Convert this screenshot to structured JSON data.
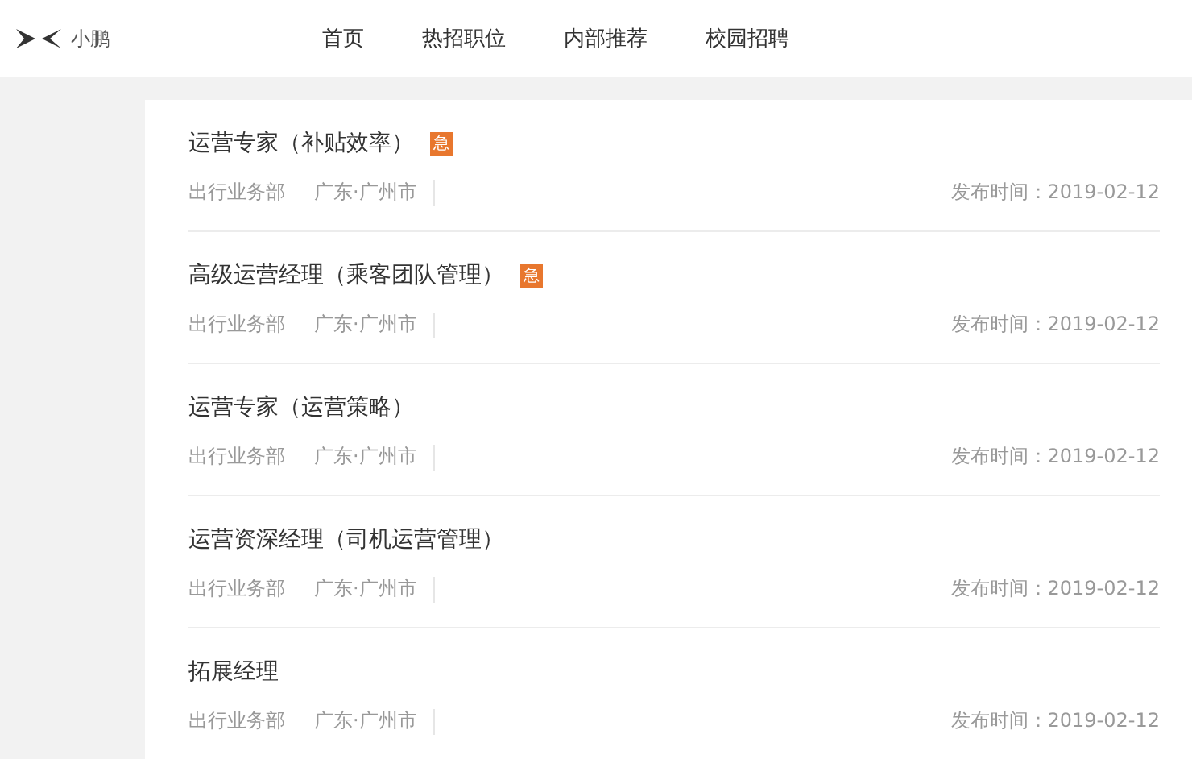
{
  "header": {
    "logo_text": "小鹏",
    "nav": [
      {
        "label": "首页"
      },
      {
        "label": "热招职位"
      },
      {
        "label": "内部推荐"
      },
      {
        "label": "校园招聘"
      }
    ]
  },
  "jobs": [
    {
      "title": "运营专家（补贴效率）",
      "badge": "急",
      "department": "出行业务部",
      "location": "广东·广州市",
      "published": "发布时间：2019-02-12"
    },
    {
      "title": "高级运营经理（乘客团队管理）",
      "badge": "急",
      "department": "出行业务部",
      "location": "广东·广州市",
      "published": "发布时间：2019-02-12"
    },
    {
      "title": "运营专家（运营策略）",
      "department": "出行业务部",
      "location": "广东·广州市",
      "published": "发布时间：2019-02-12"
    },
    {
      "title": "运营资深经理（司机运营管理）",
      "department": "出行业务部",
      "location": "广东·广州市",
      "published": "发布时间：2019-02-12"
    },
    {
      "title": "拓展经理",
      "department": "出行业务部",
      "location": "广东·广州市",
      "published": "发布时间：2019-02-12"
    }
  ]
}
